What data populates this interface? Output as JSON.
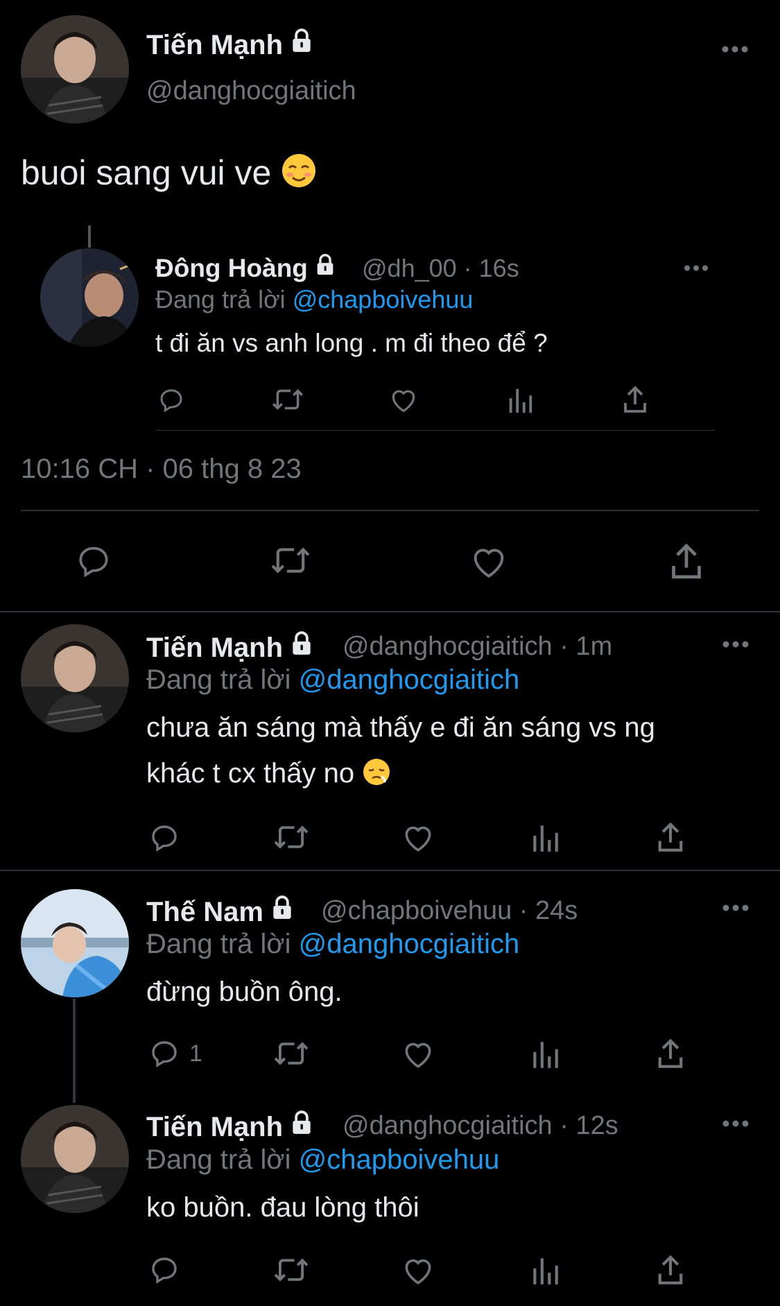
{
  "main_tweet": {
    "name": "Tiến Mạnh",
    "handle": "@danghocgiaitich",
    "text": "buoi sang vui ve",
    "emoji": "smiling-face-icon",
    "timestamp": "10:16 CH · 06 thg 8 23"
  },
  "quoted": {
    "name": "Đông Hoàng",
    "handle": "@dh_00 · 16s",
    "reply_prefix": "Đang trả lời",
    "reply_to": "@chapboivehuu",
    "text": "t đi ăn vs anh long . m đi theo để ?"
  },
  "replies": [
    {
      "name": "Tiến Mạnh",
      "handle": "@danghocgiaitich · 1m",
      "reply_prefix": "Đang trả lời",
      "reply_to": "@danghocgiaitich",
      "line1": "chưa ăn sáng mà thấy e đi ăn sáng vs ng",
      "line2": "khác t cx thấy no",
      "emoji": "sad-face-icon"
    },
    {
      "name": "Thế Nam",
      "handle": "@chapboivehuu · 24s",
      "reply_prefix": "Đang trả lời",
      "reply_to": "@danghocgiaitich",
      "line1": "đừng buồn ông.",
      "reply_count": "1"
    },
    {
      "name": "Tiến Mạnh",
      "handle": "@danghocgiaitich · 12s",
      "reply_prefix": "Đang trả lời",
      "reply_to": "@chapboivehuu",
      "line1": "ko buồn. đau lòng thôi"
    }
  ],
  "colors": {
    "background": "#000000",
    "text": "#e7e9ea",
    "secondary": "#71767b",
    "accent": "#1d9bf0",
    "divider": "#2f3336"
  }
}
